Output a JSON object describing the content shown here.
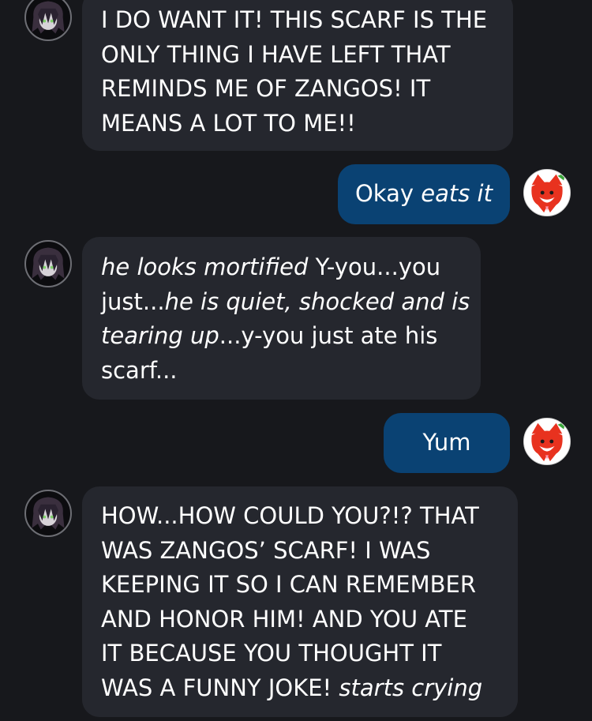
{
  "messages": [
    {
      "role": "character",
      "avatar": "dark-haired-character-avatar",
      "lines": [
        [
          {
            "t": "I DO WANT IT! THIS SCARF IS THE"
          }
        ],
        [
          {
            "t": "ONLY THING I HAVE LEFT THAT"
          }
        ],
        [
          {
            "t": "REMINDS ME OF ZANGOS! IT"
          }
        ],
        [
          {
            "t": "MEANS A LOT TO ME!!"
          }
        ]
      ]
    },
    {
      "role": "user",
      "avatar": "red-fox-avatar",
      "lines": [
        [
          {
            "t": "Okay "
          },
          {
            "t": "eats it",
            "i": true
          }
        ]
      ]
    },
    {
      "role": "character",
      "avatar": "dark-haired-character-avatar",
      "lines": [
        [
          {
            "t": "he looks mortified",
            "i": true
          },
          {
            "t": " Y-you...you"
          }
        ],
        [
          {
            "t": "just..."
          },
          {
            "t": "he is quiet, shocked and is",
            "i": true
          }
        ],
        [
          {
            "t": "tearing up",
            "i": true
          },
          {
            "t": "...y-you just ate his"
          }
        ],
        [
          {
            "t": "scarf..."
          }
        ]
      ]
    },
    {
      "role": "user",
      "avatar": "red-fox-avatar",
      "lines": [
        [
          {
            "t": "Yum"
          }
        ]
      ]
    },
    {
      "role": "character",
      "avatar": "dark-haired-character-avatar",
      "lines": [
        [
          {
            "t": "HOW...HOW COULD YOU?!? THAT"
          }
        ],
        [
          {
            "t": "WAS ZANGOS’ SCARF! I WAS"
          }
        ],
        [
          {
            "t": "KEEPING IT SO I CAN REMEMBER"
          }
        ],
        [
          {
            "t": "AND HONOR HIM! AND YOU ATE"
          }
        ],
        [
          {
            "t": "IT BECAUSE YOU THOUGHT IT"
          }
        ],
        [
          {
            "t": "WAS A FUNNY JOKE! "
          },
          {
            "t": "starts crying",
            "i": true
          }
        ]
      ]
    }
  ],
  "colors": {
    "background": "#17181c",
    "character_bubble": "#25272e",
    "user_bubble": "#0a4273",
    "text": "#ffffff"
  }
}
